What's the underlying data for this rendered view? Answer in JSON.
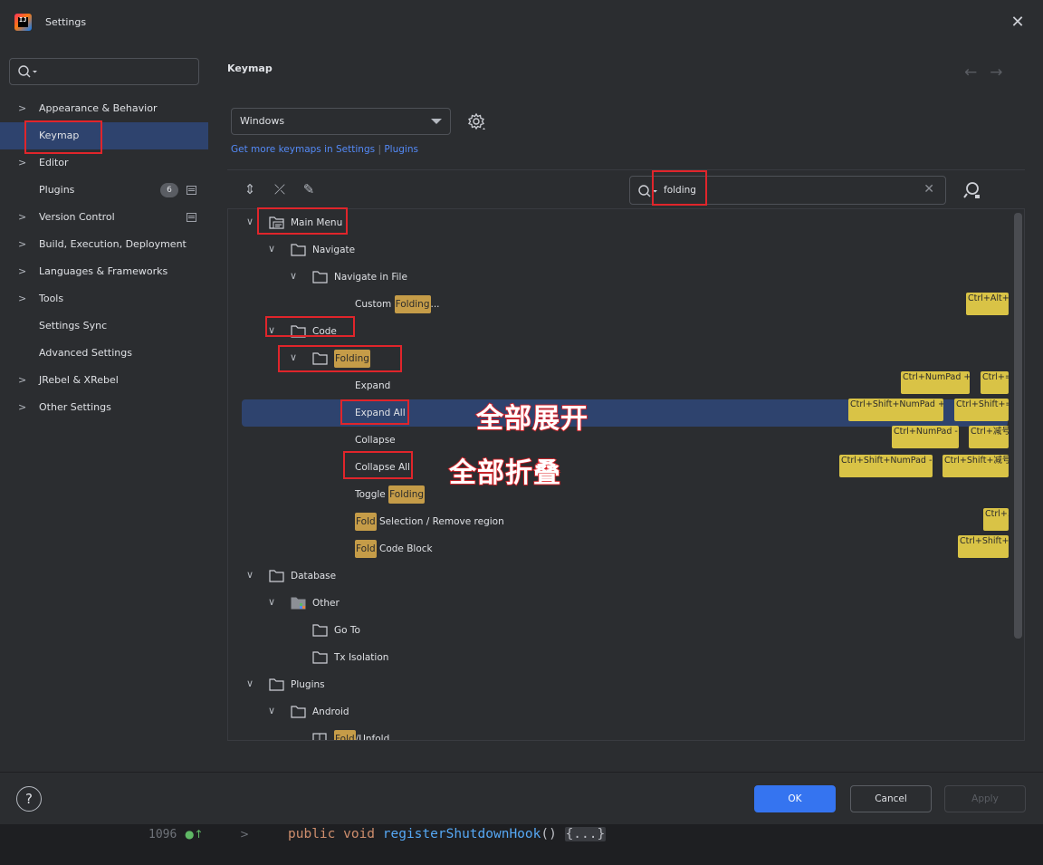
{
  "window": {
    "title": "Settings",
    "close_glyph": "✕"
  },
  "sidebar": {
    "search_placeholder": "",
    "items": [
      {
        "label": "Appearance & Behavior",
        "expandable": true
      },
      {
        "label": "Keymap",
        "expandable": false,
        "selected": true
      },
      {
        "label": "Editor",
        "expandable": true
      },
      {
        "label": "Plugins",
        "expandable": false,
        "badge": "6"
      },
      {
        "label": "Version Control",
        "expandable": true
      },
      {
        "label": "Build, Execution, Deployment",
        "expandable": true
      },
      {
        "label": "Languages & Frameworks",
        "expandable": true
      },
      {
        "label": "Tools",
        "expandable": true
      },
      {
        "label": "Settings Sync",
        "expandable": false
      },
      {
        "label": "Advanced Settings",
        "expandable": false
      },
      {
        "label": "JRebel & XRebel",
        "expandable": true
      },
      {
        "label": "Other Settings",
        "expandable": true
      }
    ]
  },
  "main": {
    "title": "Keymap",
    "keymap_select": "Windows",
    "more_link": {
      "text": "Get more keymaps in Settings",
      "sep": "|",
      "plugins": "Plugins"
    },
    "search": {
      "value": "folding"
    },
    "tree": {
      "main_menu": "Main Menu",
      "navigate": "Navigate",
      "navigate_in_file": "Navigate in File",
      "custom_folding_pre": "Custom ",
      "custom_folding_hl": "Folding",
      "custom_folding_post": "...",
      "code": "Code",
      "folding": "Folding",
      "expand": "Expand",
      "expand_all": "Expand All",
      "collapse": "Collapse",
      "collapse_all": "Collapse All",
      "toggle_pre": "Toggle ",
      "toggle_hl": "Folding",
      "fold_sel_hl": "Fold",
      "fold_sel_post": " Selection / Remove region",
      "fold_code_hl": "Fold",
      "fold_code_post": " Code Block",
      "database": "Database",
      "other": "Other",
      "go_to": "Go To",
      "tx_isolation": "Tx Isolation",
      "plugins": "Plugins",
      "android": "Android",
      "fold_unfold_hl": "Fold",
      "fold_unfold_post": "/Unfold"
    },
    "shortcuts": {
      "custom_folding": [
        "Ctrl+Alt+."
      ],
      "expand": [
        "Ctrl+NumPad +",
        "Ctrl+="
      ],
      "expand_all": [
        "Ctrl+Shift+NumPad +",
        "Ctrl+Shift+="
      ],
      "collapse": [
        "Ctrl+NumPad -",
        "Ctrl+减号"
      ],
      "collapse_all": [
        "Ctrl+Shift+NumPad -",
        "Ctrl+Shift+减号"
      ],
      "fold_selection": [
        "Ctrl+."
      ],
      "fold_code_block": [
        "Ctrl+Shift+."
      ]
    },
    "annotations": {
      "expand_all": "全部展开",
      "collapse_all": "全部折叠"
    }
  },
  "footer": {
    "help": "?",
    "ok": "OK",
    "cancel": "Cancel",
    "apply": "Apply"
  },
  "editor": {
    "line_number": "1096",
    "code_kw": "public void ",
    "code_fn": "registerShutdownHook",
    "code_paren": "() ",
    "code_fold": "{...}"
  },
  "colors": {
    "selection": "#2e436e",
    "accent": "#3574f0",
    "highlight": "#c59c48",
    "shortcut": "#d9c346",
    "annotation_red": "#e0252b"
  }
}
